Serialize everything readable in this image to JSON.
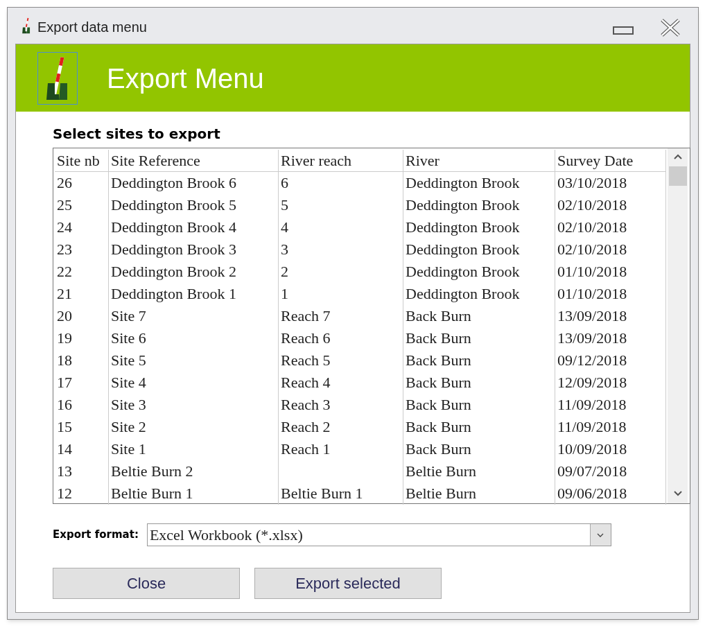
{
  "window": {
    "title": "Export data menu"
  },
  "header": {
    "title": "Export Menu"
  },
  "section_label": "Select sites to export",
  "table": {
    "columns": [
      "Site nb",
      "Site Reference",
      "River reach",
      "River",
      "Survey Date"
    ],
    "rows": [
      [
        "26",
        "Deddington Brook 6",
        "6",
        "Deddington Brook",
        "03/10/2018"
      ],
      [
        "25",
        "Deddington Brook 5",
        "5",
        "Deddington Brook",
        "02/10/2018"
      ],
      [
        "24",
        "Deddington Brook 4",
        "4",
        "Deddington Brook",
        "02/10/2018"
      ],
      [
        "23",
        "Deddington Brook 3",
        "3",
        "Deddington Brook",
        "02/10/2018"
      ],
      [
        "22",
        "Deddington Brook 2",
        "2",
        "Deddington Brook",
        "01/10/2018"
      ],
      [
        "21",
        "Deddington Brook 1",
        "1",
        "Deddington Brook",
        "01/10/2018"
      ],
      [
        "20",
        "Site 7",
        "Reach 7",
        "Back Burn",
        "13/09/2018"
      ],
      [
        "19",
        "Site 6",
        "Reach 6",
        "Back Burn",
        "13/09/2018"
      ],
      [
        "18",
        "Site 5",
        "Reach 5",
        "Back Burn",
        "09/12/2018"
      ],
      [
        "17",
        "Site 4",
        "Reach 4",
        "Back Burn",
        "12/09/2018"
      ],
      [
        "16",
        "Site 3",
        "Reach 3",
        "Back Burn",
        "11/09/2018"
      ],
      [
        "15",
        "Site 2",
        "Reach 2",
        "Back Burn",
        "11/09/2018"
      ],
      [
        "14",
        "Site 1",
        "Reach 1",
        "Back Burn",
        "10/09/2018"
      ],
      [
        "13",
        "Beltie Burn 2",
        "",
        "Beltie Burn",
        "09/07/2018"
      ],
      [
        "12",
        "Beltie Burn 1",
        "Beltie Burn 1",
        "Beltie Burn",
        "09/06/2018"
      ]
    ]
  },
  "export_format": {
    "label": "Export format:",
    "value": "Excel Workbook (*.xlsx)"
  },
  "buttons": [
    "Close",
    "Export selected"
  ]
}
